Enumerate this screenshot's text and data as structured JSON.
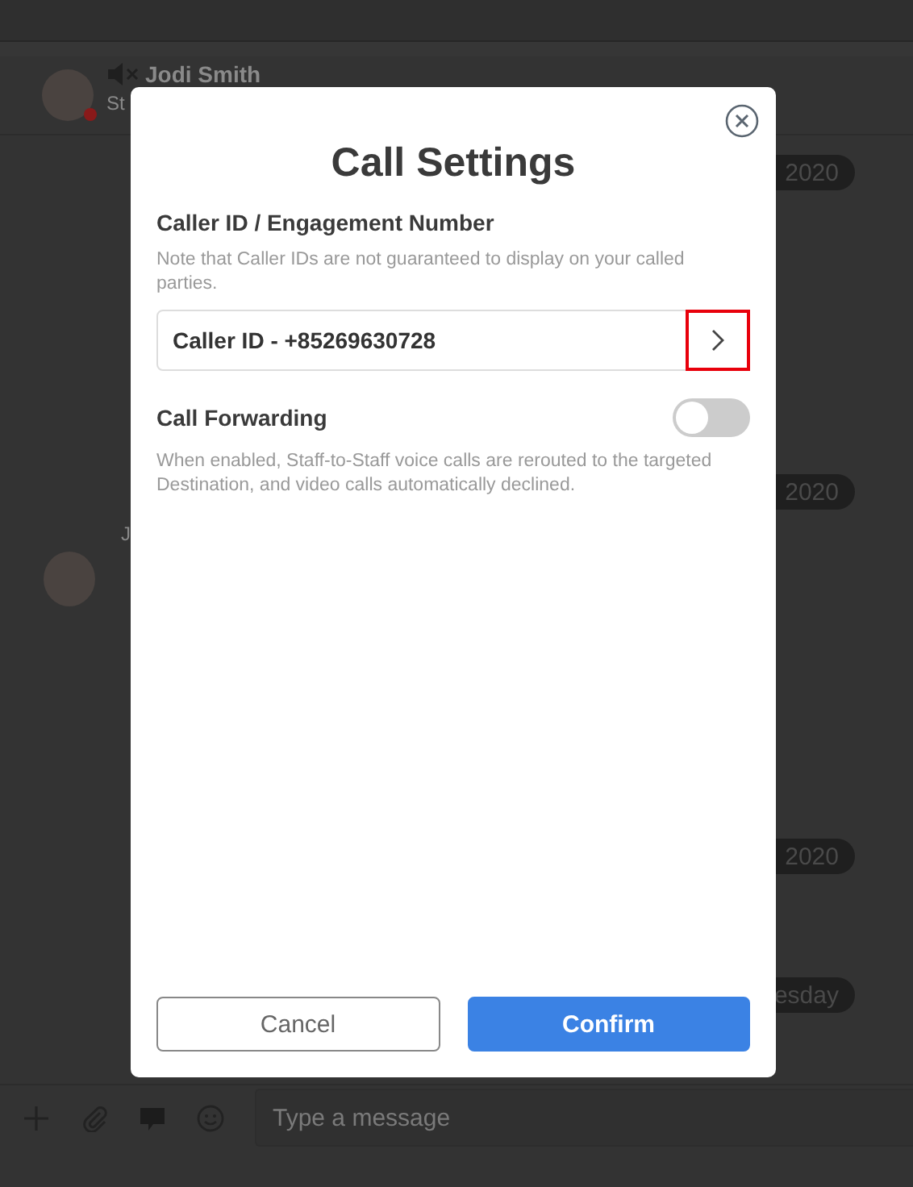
{
  "app": {
    "contact": {
      "name": "Jodi Smith",
      "status": "St"
    },
    "date_badges": [
      {
        "label": "2020"
      },
      {
        "label": "2020"
      },
      {
        "label": "2020"
      },
      {
        "label": "esday"
      }
    ],
    "message_sender": "J",
    "composer": {
      "placeholder": "Type a message"
    }
  },
  "dialog": {
    "title": "Call Settings",
    "caller_id": {
      "heading": "Caller ID / Engagement Number",
      "note": "Note that Caller IDs are not guaranteed to display on your called parties.",
      "value": "Caller ID - +85269630728",
      "highlighted": true
    },
    "call_forwarding": {
      "label": "Call Forwarding",
      "on": false,
      "description": "When enabled, Staff-to-Staff voice calls are rerouted to the targeted Destination, and video calls automatically declined."
    },
    "buttons": [
      {
        "label": "Cancel",
        "kind": "secondary"
      },
      {
        "label": "Confirm",
        "kind": "primary"
      }
    ]
  }
}
